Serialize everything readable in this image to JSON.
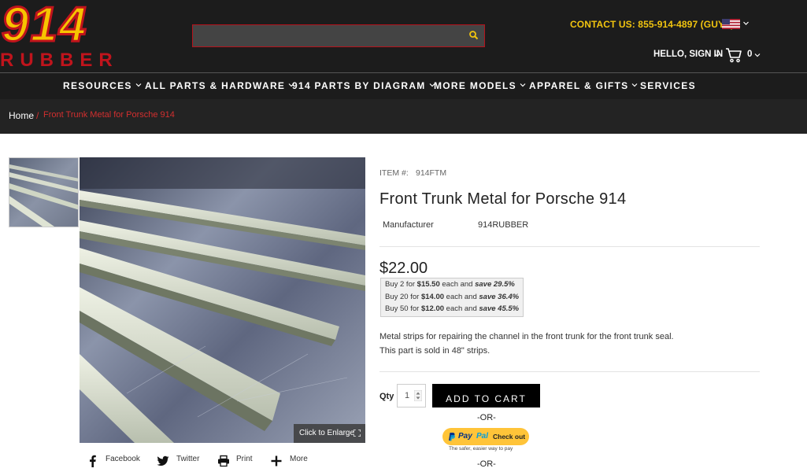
{
  "header": {
    "logo_text_top": "914",
    "logo_text_bottom": "RUBBER",
    "search": {
      "placeholder": "",
      "value": ""
    },
    "contact": "CONTACT US: 855-914-4897 (GUYS)",
    "signin": "HELLO, SIGN IN",
    "cart_count": "0"
  },
  "nav": {
    "items": [
      {
        "label": "RESOURCES",
        "has_dropdown": true
      },
      {
        "label": "ALL PARTS & HARDWARE",
        "has_dropdown": true
      },
      {
        "label": "914 PARTS BY DIAGRAM",
        "has_dropdown": true
      },
      {
        "label": "MORE MODELS",
        "has_dropdown": true
      },
      {
        "label": "APPAREL & GIFTS",
        "has_dropdown": true
      },
      {
        "label": "SERVICES",
        "has_dropdown": false
      }
    ]
  },
  "breadcrumb": {
    "home": "Home",
    "separator": "/",
    "current": "Front Trunk Metal for Porsche 914"
  },
  "gallery": {
    "enlarge_label": "Click to Enlarge"
  },
  "share": [
    {
      "label": "Facebook",
      "icon": "facebook-icon"
    },
    {
      "label": "Twitter",
      "icon": "twitter-icon"
    },
    {
      "label": "Print",
      "icon": "print-icon"
    },
    {
      "label": "More",
      "icon": "plus-icon"
    }
  ],
  "product": {
    "item_label": "ITEM #:",
    "item_number": "914FTM",
    "title": "Front Trunk Metal for Porsche 914",
    "manufacturer_label": "Manufacturer",
    "manufacturer": "914RUBBER",
    "price": "$22.00",
    "quantity_discounts": [
      {
        "prefix": "Buy 2 for ",
        "price": "$15.50",
        "mid": " each and ",
        "save": "save 29.5%"
      },
      {
        "prefix": "Buy 20 for ",
        "price": "$14.00",
        "mid": " each and ",
        "save": "save 36.4%"
      },
      {
        "prefix": "Buy 50 for ",
        "price": "$12.00",
        "mid": " each and ",
        "save": "save 45.5%"
      }
    ],
    "description_1": "Metal strips for repairing the channel in the front trunk for the front trunk seal.",
    "description_2": "This part is sold in 48\" strips.",
    "qty_label": "Qty",
    "qty_value": "1",
    "add_to_cart": "ADD TO CART",
    "or": "-OR-",
    "paypal_word_1": "Pay",
    "paypal_word_2": "Pal",
    "paypal_checkout": "Check out",
    "paypal_tagline": "The safer, easier way to pay"
  },
  "colors": {
    "header_bg": "#1c1c1c",
    "accent_red": "#d32f2f",
    "logo_yellow": "#f7c400",
    "contact_yellow": "#f1c40f",
    "paypal_yellow": "#ffc439"
  }
}
